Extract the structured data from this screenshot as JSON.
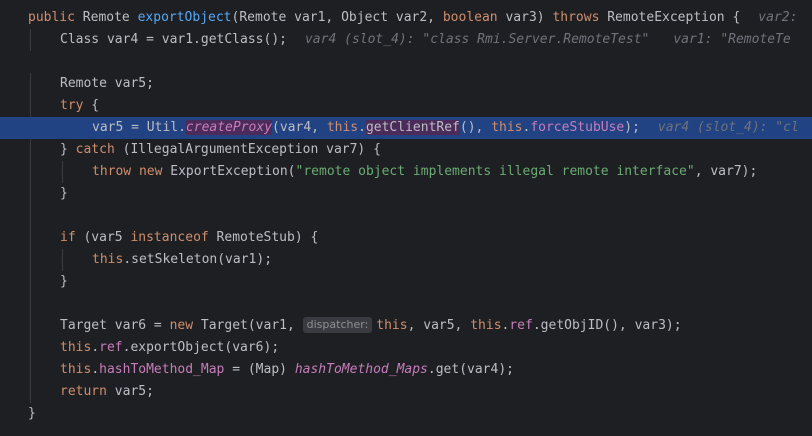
{
  "editor": {
    "lines": {
      "l1": {
        "public": "public",
        "remote_type": " Remote ",
        "method": "exportObject",
        "params_a": "(Remote var1, Object var2, ",
        "boolean": "boolean",
        "params_b": " var3) ",
        "throws": "throws",
        "exc": " RemoteException {",
        "hint": "var2:"
      },
      "l2": {
        "code": "Class var4 = var1.getClass();",
        "hint1": "var4 (slot_4): \"class Rmi.Server.RemoteTest\"",
        "hint2": "var1: \"RemoteTe"
      },
      "l4": {
        "code": "Remote var5;"
      },
      "l5": {
        "try": "try",
        "rest": " {"
      },
      "l6": {
        "a": "var5 = Util.",
        "create_proxy": "createProxy",
        "b": "(var4, ",
        "this1": "this",
        "dot1": ".",
        "get_client_ref": "getClientRef",
        "c": "(), ",
        "this2": "this",
        "dot2": ".",
        "force_stub_use": "forceStubUse",
        "d": ");",
        "hint": "var4 (slot_4): \"cl"
      },
      "l7": {
        "a": "} ",
        "catch": "catch",
        "b": " (IllegalArgumentException var7) {"
      },
      "l8": {
        "throw": "throw",
        "new": "new",
        "cls": " ExportException(",
        "str": "\"remote object implements illegal remote interface\"",
        "rest": ", var7);"
      },
      "l9": {
        "code": "}"
      },
      "l11": {
        "if": "if",
        "a": " (var5 ",
        "instanceof": "instanceof",
        "b": " RemoteStub) {"
      },
      "l12": {
        "this": "this",
        "a": ".setSkeleton(var1);"
      },
      "l13": {
        "code": "}"
      },
      "l15": {
        "a": "Target var6 = ",
        "new": "new",
        "b": " Target(var1, ",
        "param_hint": "dispatcher:",
        "this1": "this",
        "c": ", var5, ",
        "this2": "this",
        "dot": ".",
        "ref": "ref",
        "d": ".getObjID(), var3);"
      },
      "l16": {
        "this": "this",
        "dot": ".",
        "ref": "ref",
        "a": ".exportObject(var6);"
      },
      "l17": {
        "this": "this",
        "dot": ".",
        "field": "hashToMethod_Map",
        "a": " = (Map) ",
        "static_field": "hashToMethod_Maps",
        "b": ".get(var4);"
      },
      "l18": {
        "return": "return",
        "a": " var5;"
      },
      "l19": {
        "code": "}"
      }
    }
  }
}
